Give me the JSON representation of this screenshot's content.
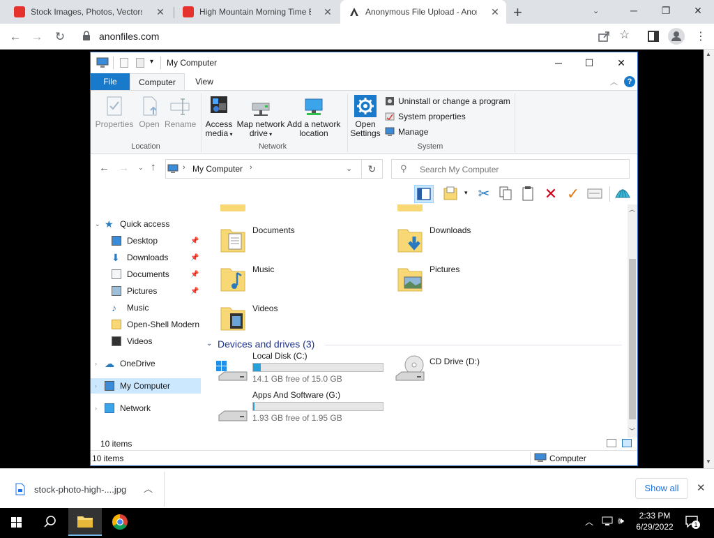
{
  "browser": {
    "tabs": [
      {
        "title": "Stock Images, Photos, Vectors, V",
        "favicon_color": "#e5322d"
      },
      {
        "title": "High Mountain Morning Time Be",
        "favicon_color": "#e5322d"
      },
      {
        "title": "Anonymous File Upload - AnonF",
        "favicon_color": "#333333"
      }
    ],
    "new_tab": "+",
    "url": "anonfiles.com"
  },
  "explorer": {
    "title": "My Computer",
    "ribbon_tabs": [
      "File",
      "Computer",
      "View"
    ],
    "location_group": {
      "label": "Location",
      "buttons": [
        "Properties",
        "Open",
        "Rename"
      ]
    },
    "network_group": {
      "label": "Network",
      "access_media": "Access media",
      "map_drive": "Map network drive",
      "add_location": "Add a network location"
    },
    "system_group": {
      "label": "System",
      "open_settings": "Open Settings",
      "uninstall": "Uninstall or change a program",
      "system_properties": "System properties",
      "manage": "Manage"
    },
    "address": "My Computer",
    "search_placeholder": "Search My Computer",
    "nav": {
      "quick_access": "Quick access",
      "desktop": "Desktop",
      "downloads": "Downloads",
      "documents": "Documents",
      "pictures": "Pictures",
      "music": "Music",
      "open_shell": "Open-Shell Modern",
      "videos": "Videos",
      "onedrive": "OneDrive",
      "my_computer": "My Computer",
      "network": "Network"
    },
    "folders": {
      "documents": "Documents",
      "downloads": "Downloads",
      "music": "Music",
      "pictures": "Pictures",
      "videos": "Videos"
    },
    "devices_header": "Devices and drives (3)",
    "drives": {
      "c_name": "Local Disk (C:)",
      "c_free": "14.1 GB free of 15.0 GB",
      "c_used_fraction": 0.06,
      "d_name": "CD Drive (D:)",
      "g_name": "Apps And Software (G:)",
      "g_free": "1.93 GB free of 1.95 GB",
      "g_used_fraction": 0.01
    },
    "status_items": "10 items",
    "status_items2": "10 items",
    "status_computer": "Computer"
  },
  "downloads": {
    "file": "stock-photo-high-....jpg",
    "show_all": "Show all"
  },
  "taskbar": {
    "time": "2:33 PM",
    "date": "6/29/2022",
    "notif_count": "1"
  }
}
